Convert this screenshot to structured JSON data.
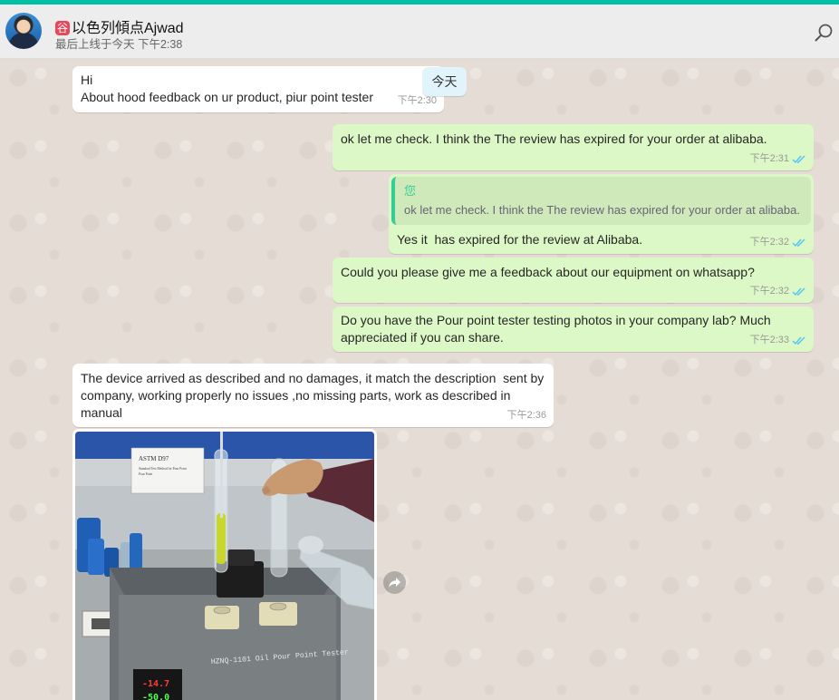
{
  "header": {
    "contact_badge": "谷",
    "contact_name": "以色列傾点Ajwad",
    "last_seen": "最后上线于今天 下午2:38"
  },
  "date_chip": "今天",
  "messages": [
    {
      "direction": "in",
      "text": "Hi\nAbout hood feedback on ur product, piur point tester",
      "time": "下午2:30"
    },
    {
      "direction": "out",
      "text": "ok let me check. I think the The review has expired for your order at alibaba.",
      "time": "下午2:31",
      "status": "read"
    },
    {
      "direction": "out",
      "quote_author": "您",
      "quote_text": "ok let me check. I think the The review has expired for your order at alibaba.",
      "text": "Yes it  has expired for the review at Alibaba.",
      "time": "下午2:32",
      "status": "read"
    },
    {
      "direction": "out",
      "text": "Could you please give me a feedback about our equipment on whatsapp?",
      "time": "下午2:32",
      "status": "read"
    },
    {
      "direction": "out",
      "text": "Do you have the Pour point tester testing photos in your company lab? Much\nappreciated if you can share.",
      "time": "下午2:33",
      "status": "read"
    },
    {
      "direction": "in",
      "text": "The device arrived as described and no damages, it match the description  sent by\ncompany, working properly no issues ,no missing parts, work as described in\nmanual",
      "time": "下午2:36"
    }
  ],
  "photo": {
    "sign_title": "ASTM D97",
    "sign_line1": "Standard Test Method for Pour Point",
    "sign_line2": "Pour Point",
    "device_label": "HZNQ-1101  Oil Pour Point Tester",
    "display_top": "-14.7",
    "display_bottom": "-50.0"
  },
  "colors": {
    "accent": "#00bfa5",
    "incoming_bubble": "#ffffff",
    "outgoing_bubble": "#dcf8c6",
    "read_ticks": "#4fc3f7"
  }
}
